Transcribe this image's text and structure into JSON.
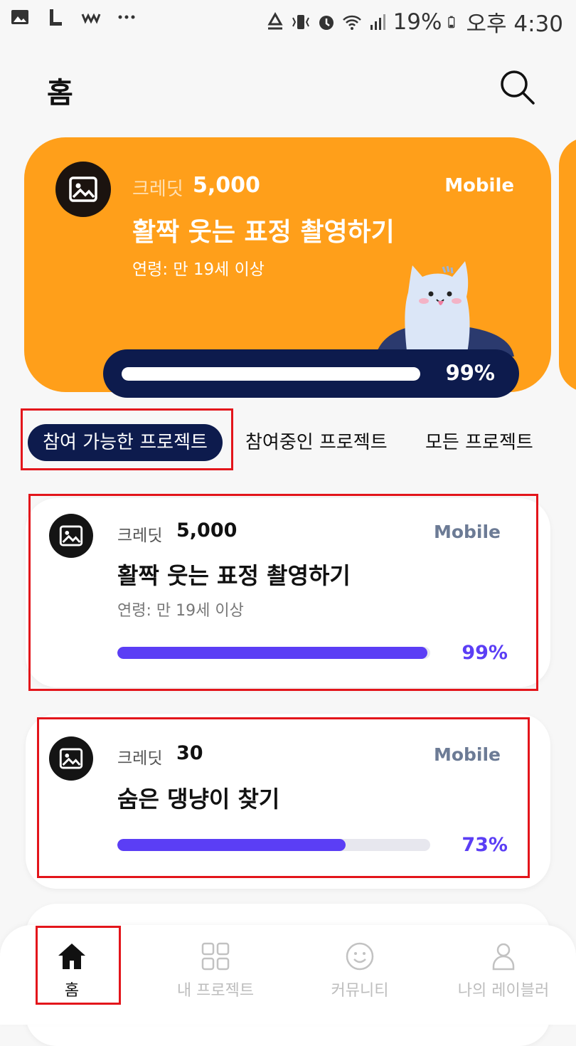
{
  "status_bar": {
    "battery": "19%",
    "time": "오후 4:30",
    "icons": [
      "gallery-icon",
      "line-icon",
      "wave-icon",
      "more-icon",
      "recycle-icon",
      "vibrate-icon",
      "alarm-icon",
      "wifi-icon",
      "signal-icon",
      "battery-icon"
    ]
  },
  "header": {
    "title": "홈",
    "search_icon": "search-icon"
  },
  "hero": {
    "credit_label": "크레딧",
    "credit_value": "5,000",
    "platform": "Mobile",
    "title": "활짝 웃는 표정 촬영하기",
    "age": "연령: 만 19세 이상",
    "progress_percent": 99,
    "progress_label": "99%",
    "colors": {
      "background": "#ff9f1a",
      "progress_bg": "#0d1b4d"
    }
  },
  "tabs": [
    {
      "label": "참여 가능한 프로젝트",
      "active": true
    },
    {
      "label": "참여중인 프로젝트",
      "active": false
    },
    {
      "label": "모든 프로젝트",
      "active": false
    }
  ],
  "cards": [
    {
      "credit_label": "크레딧",
      "credit_value": "5,000",
      "platform": "Mobile",
      "title": "활짝 웃는 표정 촬영하기",
      "age": "연령: 만 19세 이상",
      "progress_percent": 99,
      "progress_label": "99%"
    },
    {
      "credit_label": "크레딧",
      "credit_value": "30",
      "platform": "Mobile",
      "title": "숨은 댕냥이 찾기",
      "progress_percent": 73,
      "progress_label": "73%"
    }
  ],
  "bottom_nav": [
    {
      "label": "홈",
      "icon": "home-icon",
      "active": true
    },
    {
      "label": "내 프로젝트",
      "icon": "grid-icon",
      "active": false
    },
    {
      "label": "커뮤니티",
      "icon": "smiley-icon",
      "active": false
    },
    {
      "label": "나의 레이블러",
      "icon": "profile-icon",
      "active": false
    }
  ],
  "colors": {
    "accent": "#5b3ef5",
    "navy": "#0d1b4d",
    "highlight_box": "#e3151b",
    "platform_text": "#6c7b95"
  }
}
